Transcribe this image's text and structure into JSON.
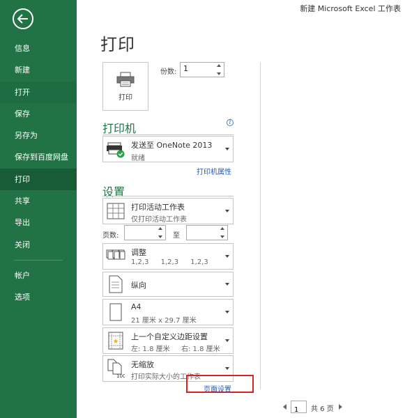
{
  "window": {
    "title": "新建 Microsoft Excel 工作表"
  },
  "sidebar": {
    "items": [
      {
        "label": "信息"
      },
      {
        "label": "新建"
      },
      {
        "label": "打开"
      },
      {
        "label": "保存"
      },
      {
        "label": "另存为"
      },
      {
        "label": "保存到百度网盘"
      },
      {
        "label": "打印"
      },
      {
        "label": "共享"
      },
      {
        "label": "导出"
      },
      {
        "label": "关闭"
      }
    ],
    "bottom_items": [
      {
        "label": "帐户"
      },
      {
        "label": "选项"
      }
    ]
  },
  "main": {
    "title": "打印",
    "print_button": "打印",
    "copies": {
      "label": "份数:",
      "value": "1"
    },
    "printer": {
      "section_title": "打印机",
      "name": "发送至 OneNote 2013",
      "status": "就绪",
      "properties_link": "打印机属性"
    },
    "settings": {
      "section_title": "设置",
      "scope": {
        "main": "打印活动工作表",
        "sub": "仅打印活动工作表"
      },
      "pages": {
        "label": "页数:",
        "to_label": "至",
        "from_value": "",
        "to_value": ""
      },
      "collate": {
        "main": "调整",
        "sub": [
          "1,2,3",
          "1,2,3",
          "1,2,3"
        ]
      },
      "orientation": {
        "main": "纵向"
      },
      "paper": {
        "main": "A4",
        "sub": "21 厘米 x 29.7 厘米"
      },
      "margins": {
        "main": "上一个自定义边距设置",
        "sub_left": "左: 1.8 厘米",
        "sub_right": "右: 1.8 厘米"
      },
      "scaling": {
        "main": "无缩放",
        "sub": "打印实际大小的工作表"
      },
      "page_setup_link": "页面设置"
    },
    "preview": {
      "current_page": "1",
      "total": "共 6 页"
    }
  },
  "colors": {
    "sidebar": "#217346",
    "accent": "#217346",
    "link": "#2a5db0",
    "highlight_box": "#e02020"
  }
}
